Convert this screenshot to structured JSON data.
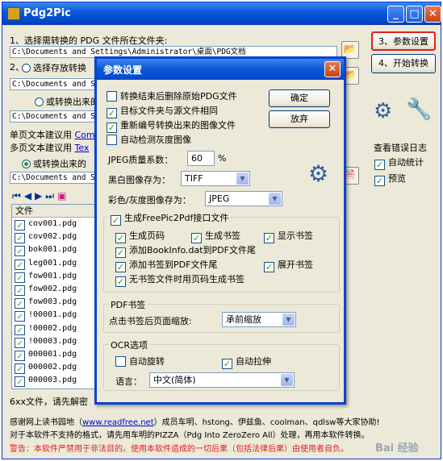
{
  "window": {
    "title": "Pdg2Pic"
  },
  "step1": {
    "label": "1、选择需转换的 PDG 文件所在文件夹:",
    "path": "C:\\Documents and Settings\\Administrator\\桌面\\PDG文档"
  },
  "step2": {
    "label": "2、"
  },
  "options": {
    "radio1": "选择存放转换",
    "path2": "C:\\Documents and S",
    "radio2": "或转换出来的",
    "path3": "C:\\Documents and S",
    "single_page_a": "单页文本建议用",
    "single_page_a_link": "Com",
    "multi_page_b": "多页文本建议用",
    "multi_page_b_link": "Tex",
    "radio3": "或转换出来的",
    "path4": "C:\\Documents and S"
  },
  "buttons": {
    "params": "3、参数设置",
    "start": "4、开始转换"
  },
  "right_panel": {
    "error_log_title": "查看错误日志",
    "auto_stat": "自动统计",
    "preview": "预览"
  },
  "toolbar_icons": [
    "first-icon",
    "prev-icon",
    "next-icon",
    "last-icon",
    "page-icon"
  ],
  "file_list": {
    "header": "文件",
    "rows": [
      "cov001.pdg",
      "cov002.pdg",
      "bok001.pdg",
      "leg001.pdg",
      "fow001.pdg",
      "fow002.pdg",
      "fow003.pdg",
      "!00001.pdg",
      "!00002.pdg",
      "!00003.pdg",
      "000001.pdg",
      "000002.pdg",
      "000003.pdg"
    ]
  },
  "status": {
    "count": "6xx文件，请先解密",
    "thanks_prefix": "感谢网上读书园地（",
    "thanks_link": "www.readfree.net",
    "thanks_suffix": "）成员车明、hstong、伊兹鱼、coolman、qdlsw等大家协助!",
    "formats": "对于本软件不支持的格式，请先用车明的PIZZA（Pdg Into ZeroZero All）处理，再用本软件转换。",
    "warning": "警告：本软件严禁用于非法目的。使用本软件造成的一切后果（包括法律后果）由使用者自负。",
    "watermark": "Bai 经验"
  },
  "dialog": {
    "title": "参数设置",
    "ok": "确定",
    "cancel": "放弃",
    "opt_delete": "转换结束后删除原始PDG文件",
    "opt_same_folder": "目标文件夹与源文件相同",
    "opt_renumber": "重新编号转换出来的图像文件",
    "opt_gray": "自动检测灰度图像",
    "jpeg_label": "JPEG质量系数：",
    "jpeg_value": "60",
    "jpeg_unit": "%",
    "bw_label": "黑白图像存为：",
    "bw_value": "TIFF",
    "color_label": "彩色/灰度图像存为：",
    "color_value": "JPEG",
    "freepic_label": "生成FreePic2Pdf接口文件",
    "gen_page": "生成页码",
    "gen_bookmark": "生成书签",
    "show_bookmark": "显示书签",
    "add_bookinfo": "添加BookInfo.dat到PDF文件尾",
    "add_bookmark_pdf": "添加书签到PDF文件尾",
    "expand_bookmark": "展开书签",
    "no_bookmark_file": "无书签文件时用页码生成书签",
    "pdf_bookmark_group": "PDF书签",
    "zoom_label": "点击书签后页面缩放:",
    "zoom_value": "承前缩放",
    "ocr_group": "OCR选项",
    "auto_rotate": "自动旋转",
    "auto_stretch": "自动拉伸",
    "language_label": "语言：",
    "language_value": "中文(简体)"
  },
  "colors": {
    "accent_red": "#e02020",
    "title_blue": "#0a58d6"
  }
}
